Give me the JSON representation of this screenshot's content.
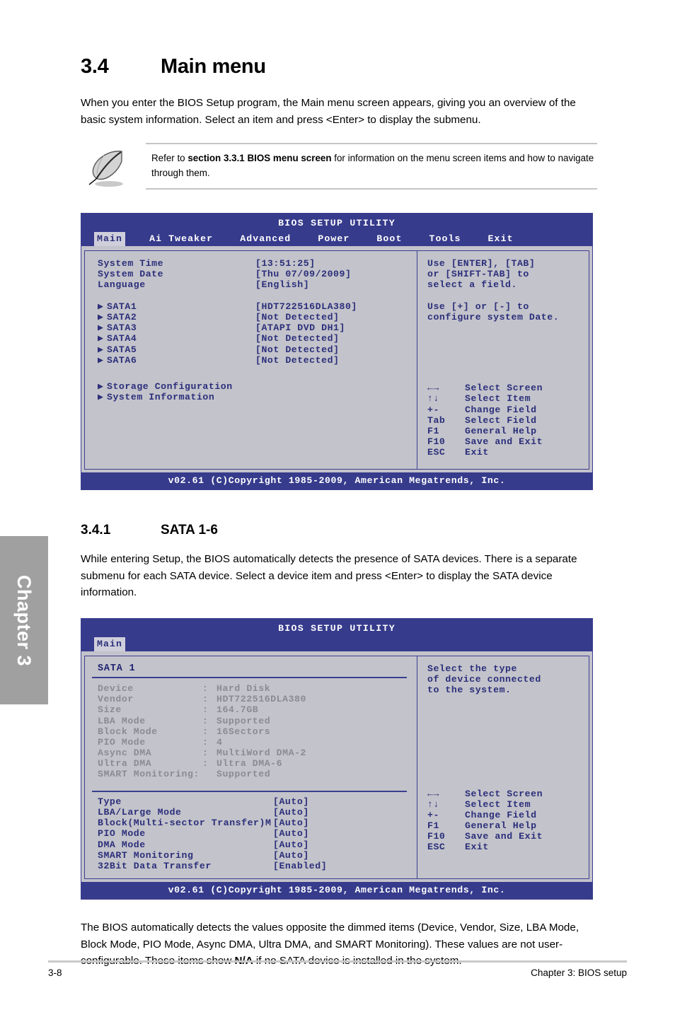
{
  "chapter_tab": {
    "label": "Chapter 3"
  },
  "section": {
    "number": "3.4",
    "title": "Main menu",
    "intro": "When you enter the BIOS Setup program, the Main menu screen appears, giving you an overview of the basic system information. Select an item and press <Enter> to display the submenu."
  },
  "note": {
    "icon": "feather-pen-icon",
    "text_before": "Refer to ",
    "bold": "section 3.3.1 BIOS menu screen",
    "text_after": " for information on the menu screen items and how to navigate through them."
  },
  "bios_main": {
    "title": "BIOS SETUP UTILITY",
    "tabs": [
      {
        "label": "Main",
        "active": true
      },
      {
        "label": "Ai Tweaker",
        "active": false
      },
      {
        "label": "Advanced",
        "active": false
      },
      {
        "label": "Power",
        "active": false
      },
      {
        "label": "Boot",
        "active": false
      },
      {
        "label": "Tools",
        "active": false
      },
      {
        "label": "Exit",
        "active": false
      }
    ],
    "items": [
      {
        "label": "System Time",
        "value": "[13:51:25]",
        "bullet": false
      },
      {
        "label": "System Date",
        "value": "[Thu 07/09/2009]",
        "bullet": false
      },
      {
        "label": "Language",
        "value": "[English]",
        "bullet": false
      }
    ],
    "sata_items": [
      {
        "label": "SATA1",
        "value": "[HDT722516DLA380]",
        "bullet": true
      },
      {
        "label": "SATA2",
        "value": "[Not Detected]",
        "bullet": true
      },
      {
        "label": "SATA3",
        "value": "[ATAPI DVD DH1]",
        "bullet": true
      },
      {
        "label": "SATA4",
        "value": "[Not Detected]",
        "bullet": true
      },
      {
        "label": "SATA5",
        "value": "[Not Detected]",
        "bullet": true
      },
      {
        "label": "SATA6",
        "value": "[Not Detected]",
        "bullet": true
      }
    ],
    "submenus": [
      {
        "label": "Storage Configuration",
        "bullet": true
      },
      {
        "label": "System Information",
        "bullet": true
      }
    ],
    "help_lines": [
      "Use [ENTER], [TAB]",
      "or [SHIFT-TAB] to",
      "select a field.",
      "",
      "Use [+] or [-] to",
      "configure system Date."
    ],
    "nav_keys": [
      {
        "key": "←→",
        "action": "Select Screen"
      },
      {
        "key": "↑↓",
        "action": "Select Item"
      },
      {
        "key": "+-",
        "action": "Change Field"
      },
      {
        "key": "Tab",
        "action": "Select Field"
      },
      {
        "key": "F1",
        "action": "General Help"
      },
      {
        "key": "F10",
        "action": "Save and Exit"
      },
      {
        "key": "ESC",
        "action": "Exit"
      }
    ],
    "footer": "v02.61 (C)Copyright 1985-2009, American Megatrends, Inc."
  },
  "subsection": {
    "number": "3.4.1",
    "title": "SATA 1-6",
    "intro": "While entering Setup, the BIOS automatically detects the presence of SATA devices. There is a separate submenu for each SATA device. Select a device item and press <Enter> to display the SATA device information."
  },
  "bios_sata": {
    "title": "BIOS SETUP UTILITY",
    "tabs": [
      {
        "label": "Main",
        "active": true
      }
    ],
    "panel_heading": "SATA 1",
    "info_items": [
      {
        "label": "Device",
        "sep": ":",
        "value": "Hard Disk"
      },
      {
        "label": "Vendor",
        "sep": ":",
        "value": "HDT722516DLA380"
      },
      {
        "label": "Size",
        "sep": ":",
        "value": "164.7GB"
      },
      {
        "label": "LBA Mode",
        "sep": ":",
        "value": "Supported"
      },
      {
        "label": "Block Mode",
        "sep": ":",
        "value": "16Sectors"
      },
      {
        "label": "PIO Mode",
        "sep": ":",
        "value": "4"
      },
      {
        "label": "Async DMA",
        "sep": ":",
        "value": "MultiWord DMA-2"
      },
      {
        "label": "Ultra DMA",
        "sep": ":",
        "value": "Ultra DMA-6"
      },
      {
        "label": "SMART Monitoring",
        "sep": ":",
        "value": "Supported"
      }
    ],
    "config_items": [
      {
        "label": "Type",
        "value": "[Auto]"
      },
      {
        "label": "LBA/Large Mode",
        "value": "[Auto]"
      },
      {
        "label": "Block(Multi-sector Transfer)M",
        "value": "[Auto]"
      },
      {
        "label": "PIO Mode",
        "value": "[Auto]"
      },
      {
        "label": "DMA Mode",
        "value": "[Auto]"
      },
      {
        "label": "SMART Monitoring",
        "value": "[Auto]"
      },
      {
        "label": "32Bit Data Transfer",
        "value": "[Enabled]"
      }
    ],
    "help_lines": [
      "Select the type",
      "of device connected",
      "to the system."
    ],
    "nav_keys": [
      {
        "key": "←→",
        "action": "Select Screen"
      },
      {
        "key": "↑↓",
        "action": "Select Item"
      },
      {
        "key": "+-",
        "action": "Change Field"
      },
      {
        "key": "F1",
        "action": "General Help"
      },
      {
        "key": "F10",
        "action": "Save and Exit"
      },
      {
        "key": "ESC",
        "action": "Exit"
      }
    ],
    "footer": "v02.61 (C)Copyright 1985-2009, American Megatrends, Inc."
  },
  "closing": {
    "part1": "The BIOS automatically detects the values opposite the dimmed items (Device, Vendor, Size, LBA Mode, Block Mode, PIO Mode, Async DMA, Ultra DMA, and SMART Monitoring). These values are not user-configurable. These items show ",
    "bold": "N/A",
    "part2": " if no SATA device is installed in the system."
  },
  "page_footer": {
    "page_number": "3-8",
    "chapter_label": "Chapter 3: BIOS setup"
  },
  "colors": {
    "bios_blue": "#363b8c",
    "bios_text": "#2b2f7a",
    "bios_bg": "#c3c3cb",
    "dim_text": "#8b8b93",
    "chapter_tab_bg": "#a0a0a0"
  }
}
